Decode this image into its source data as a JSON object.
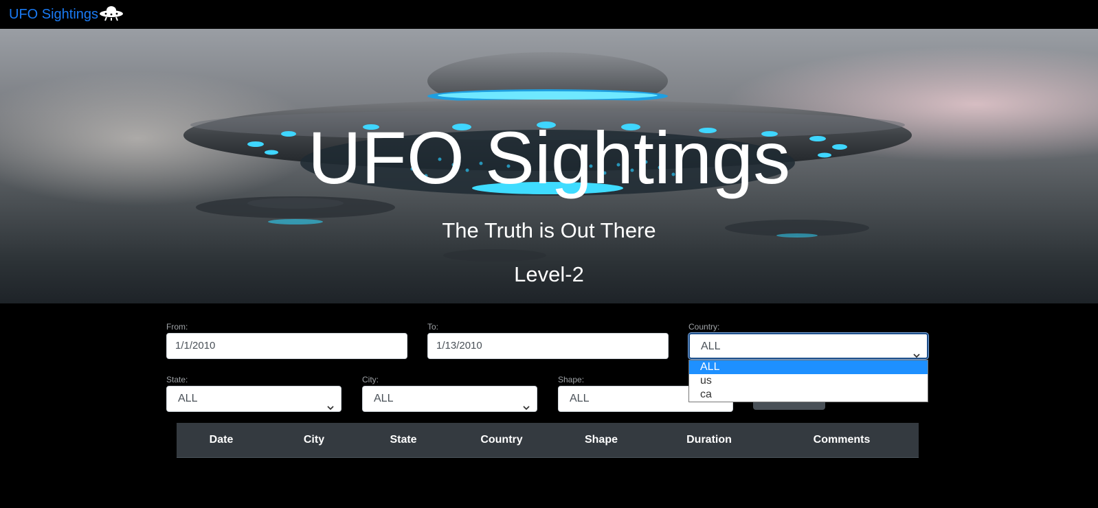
{
  "navbar": {
    "brand": "UFO Sightings",
    "brand_icon": "ufo-icon"
  },
  "hero": {
    "title": "UFO Sightings",
    "subtitle": "The Truth is Out There",
    "level": "Level-2"
  },
  "filters": {
    "from": {
      "label": "From:",
      "value": "1/1/2010"
    },
    "to": {
      "label": "To:",
      "value": "1/13/2010"
    },
    "country": {
      "label": "Country:",
      "value": "ALL",
      "options": [
        "ALL",
        "us",
        "ca"
      ],
      "open": true
    },
    "state": {
      "label": "State:",
      "value": "ALL"
    },
    "city": {
      "label": "City:",
      "value": "ALL"
    },
    "shape": {
      "label": "Shape:",
      "value": "ALL"
    }
  },
  "table": {
    "headers": [
      "Date",
      "City",
      "State",
      "Country",
      "Shape",
      "Duration",
      "Comments"
    ]
  },
  "colors": {
    "brand": "#1a7bf5",
    "table_header_bg": "#343a40",
    "selected_option": "#1e90ff"
  }
}
